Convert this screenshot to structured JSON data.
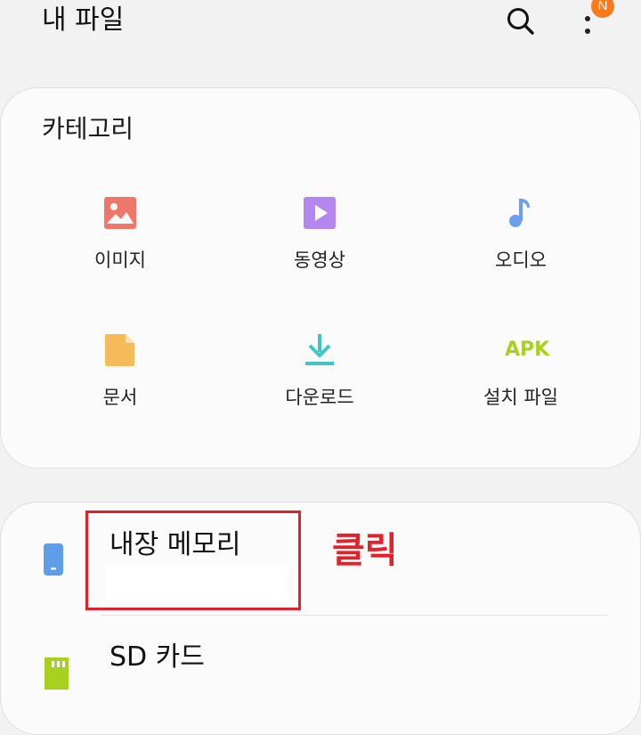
{
  "app_bar": {
    "title": "내 파일",
    "notification_badge": "N",
    "search_icon": "search-icon",
    "more_icon": "more-vert-icon"
  },
  "categories": {
    "title": "카테고리",
    "items": [
      {
        "label": "이미지",
        "icon": "image-icon",
        "color": "#ee7769"
      },
      {
        "label": "동영상",
        "icon": "video-icon",
        "color": "#b387ef"
      },
      {
        "label": "오디오",
        "icon": "audio-icon",
        "color": "#6d9df2"
      },
      {
        "label": "문서",
        "icon": "document-icon",
        "color": "#f5bb5b"
      },
      {
        "label": "다운로드",
        "icon": "download-icon",
        "color": "#3fc6c6"
      },
      {
        "label": "설치 파일",
        "icon": "apk-icon",
        "icon_text": "APK",
        "color": "#a6d21f"
      }
    ]
  },
  "storage": {
    "internal_label": "내장 메모리",
    "sd_label": "SD 카드",
    "internal_icon": "phone-storage-icon",
    "sd_icon": "sd-card-icon"
  },
  "annotation": {
    "click_text": "클릭",
    "color": "#e3212a"
  }
}
